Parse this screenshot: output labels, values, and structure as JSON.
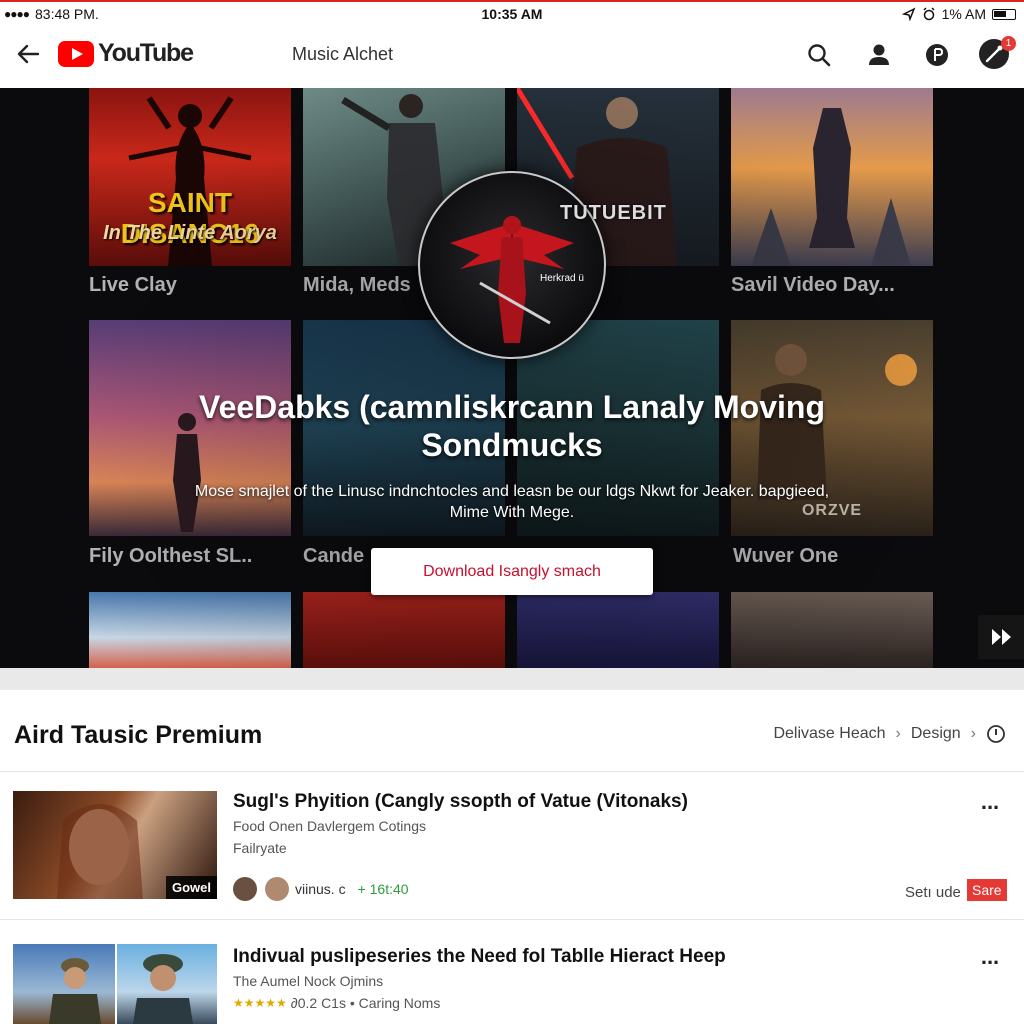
{
  "status_bar": {
    "left_text": "83:48 PM.",
    "time": "10:35 AM",
    "right_text": "1% AM"
  },
  "app_bar": {
    "logo_text": "YouTube",
    "title": "Music Alchet",
    "icons": [
      "back-arrow-icon",
      "search-icon",
      "account-icon",
      "cast-icon",
      "notifications-icon"
    ],
    "notification_badge": "1"
  },
  "hero": {
    "tiles": [
      {
        "caption": "Live Clay",
        "poster_title": "SAINT DISANC16",
        "poster_subtitle": "In The Linte Aorya"
      },
      {
        "caption": "Mida, Meds"
      },
      {
        "caption": ""
      },
      {
        "caption": "Savil Video Day..."
      },
      {
        "caption": "Fily Oolthest SL.."
      },
      {
        "caption": "Cande"
      },
      {
        "caption": ""
      },
      {
        "caption": "Wuver One",
        "poster_title": "ORZVE"
      }
    ],
    "emblem_title": "TUTUEBIT",
    "emblem_text": "Herkrad ü",
    "headline": "VeeDabks (camnliskrcann Lanaly Moving Sondmucks",
    "subtext": "Mose smajlet of the Linusc indnchtocles and leasn be our ldgs Nkwt for Jeaker. bapgieed, Mime With Mege.",
    "download_button": "Download Isangly smach",
    "next_icon": "fast-forward-icon"
  },
  "section": {
    "title": "Aird Tausic Premium",
    "links": [
      "Delivase Heach",
      "Design"
    ],
    "info_icon": "info-icon"
  },
  "videos": [
    {
      "title": "Sugl's Phyition (Cangly ssopth of Vatue (Vitonaks)",
      "line1": "Food Onen Davlergem Cotings",
      "line2": "Failryate",
      "thumb_badge": "Gowel",
      "channel": "viinus. c",
      "stat": "+ 16t:40",
      "action_text": "Setı ude",
      "action_badge": "Sare"
    },
    {
      "title": "Indivual puslipeseries the Need fol Tablle Hieract Heep",
      "line1": "The Aumel Nock Ojmins",
      "rating": "★★★★★",
      "line2_rest": "∂0.2 C1s • Caring Noms"
    }
  ],
  "colors": {
    "brand_red": "#ff0000",
    "button_text_red": "#c8102e",
    "badge_red": "#e53935",
    "green": "#2e9d3a"
  }
}
